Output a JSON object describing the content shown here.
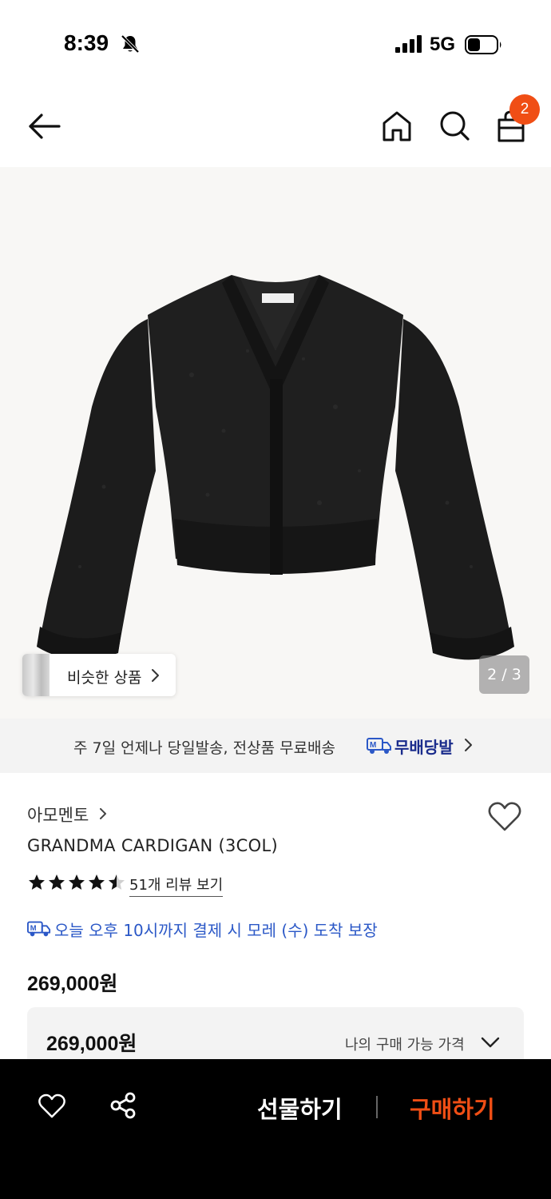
{
  "status_bar": {
    "time": "8:39",
    "network": "5G",
    "icons": [
      "bell-slash-icon",
      "signal-bars-icon",
      "battery-icon"
    ]
  },
  "nav": {
    "cart_count": "2",
    "icons": [
      "arrow-left-icon",
      "home-icon",
      "search-icon",
      "shopping-bag-icon"
    ]
  },
  "gallery": {
    "similar_label": "비슷한 상품",
    "counter": "2 / 3",
    "image_subject": "black knit cardigan"
  },
  "delivery_banner": {
    "text": "주 7일 언제나 당일발송, 전상품 무료배송",
    "brand": "무배당발"
  },
  "product": {
    "brand": "아모멘토",
    "name": "GRANDMA CARDIGAN (3COL)",
    "rating": 4.5,
    "review_link": "51개 리뷰 보기",
    "arrival": "오늘 오후 10시까지 결제 시 모레 (수) 도착 보장",
    "price": "269,000원"
  },
  "price_box": {
    "price": "269,000원",
    "label": "나의 구매 가능 가격"
  },
  "bottom_bar": {
    "gift": "선물하기",
    "buy": "구매하기"
  },
  "colors": {
    "accent": "#f04e15",
    "link_blue": "#2b58c7",
    "brand_navy": "#1a2c8c"
  }
}
